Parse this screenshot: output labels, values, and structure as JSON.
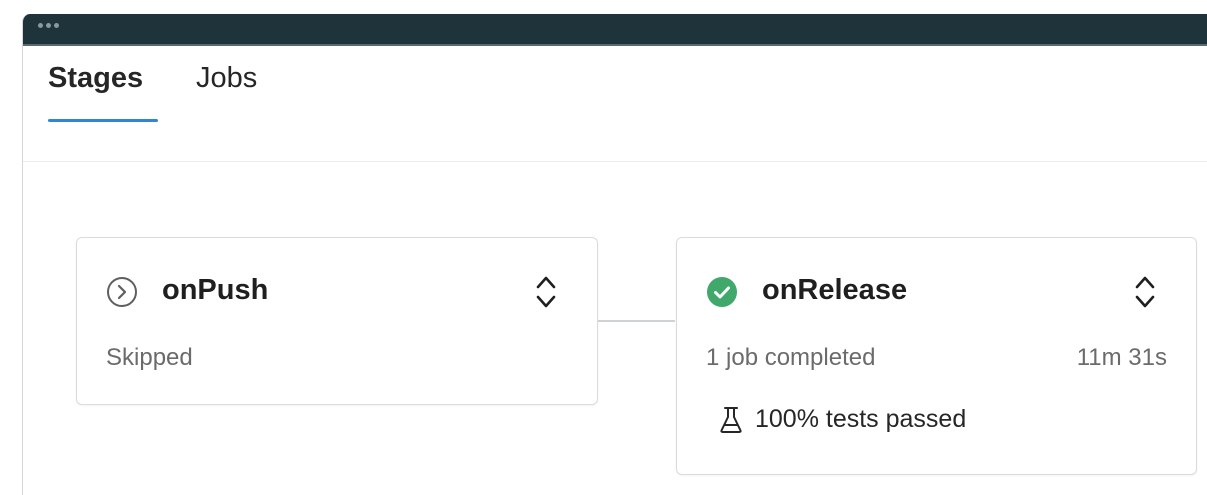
{
  "tabs": {
    "stages_label": "Stages",
    "jobs_label": "Jobs",
    "active": "Stages"
  },
  "stages": [
    {
      "name": "onPush",
      "status": "skipped",
      "status_icon": "skipped-icon",
      "summary": "Skipped"
    },
    {
      "name": "onRelease",
      "status": "succeeded",
      "status_icon": "success-check-icon",
      "summary": "1 job completed",
      "duration": "11m 31s",
      "tests_icon": "flask-icon",
      "tests_text": "100% tests passed"
    }
  ],
  "colors": {
    "titlebar": "#1f333b",
    "tab_underline": "#2f86d6",
    "success": "#3fa86a",
    "text_primary": "#1f1f1f",
    "text_secondary": "#6b6b6b"
  }
}
